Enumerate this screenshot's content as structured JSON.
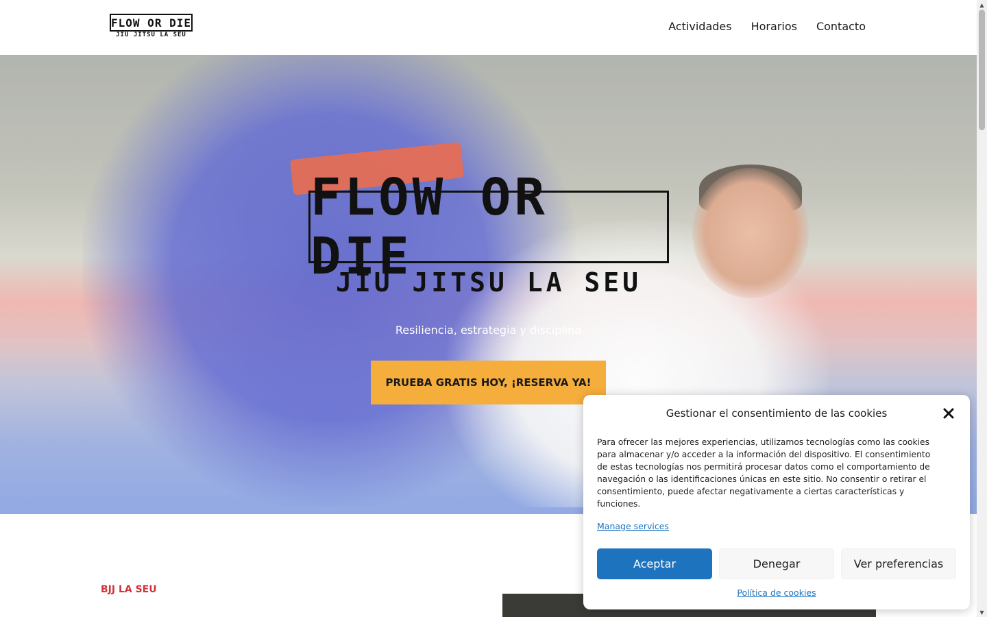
{
  "header": {
    "logo": {
      "title": "FLOW OR DIE",
      "subtitle": "JIU JITSU LA SEU"
    },
    "nav": [
      {
        "label": "Actividades"
      },
      {
        "label": "Horarios"
      },
      {
        "label": "Contacto"
      }
    ]
  },
  "hero": {
    "logo_title": "FLOW OR DIE",
    "logo_subtitle": "JIU JITSU LA SEU",
    "tagline": "Resiliencia, estrategia y disciplina",
    "cta_label": "PRUEBA GRATIS HOY, ¡RESERVA YA!",
    "cta_color": "#f5ad3c"
  },
  "section": {
    "label": "BJJ LA SEU",
    "label_color": "#d0343a"
  },
  "cookie_banner": {
    "title": "Gestionar el consentimiento de las cookies",
    "close_icon": "close-icon",
    "body": "Para ofrecer las mejores experiencias, utilizamos tecnologías como las cookies para almacenar y/o acceder a la información del dispositivo. El consentimiento de estas tecnologías nos permitirá procesar datos como el comportamiento de navegación o las identificaciones únicas en este sitio. No consentir o retirar el consentimiento, puede afectar negativamente a ciertas características y funciones.",
    "manage_link": "Manage services",
    "buttons": {
      "accept": "Aceptar",
      "deny": "Denegar",
      "preferences": "Ver preferencias"
    },
    "policy_link": "Política de cookies",
    "accent_color": "#1e73be"
  }
}
